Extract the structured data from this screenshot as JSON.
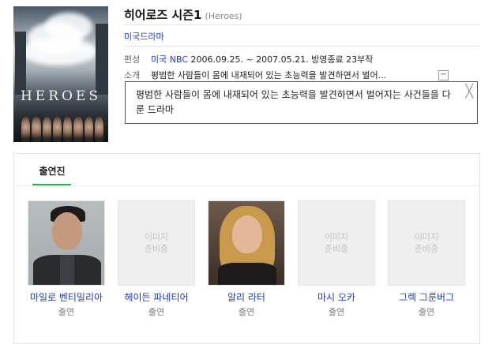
{
  "drama": {
    "title": "히어로즈 시즌1",
    "title_en": "(Heroes)",
    "genre": "미국드라마",
    "poster_logo": "HEROES"
  },
  "info": {
    "broadcast_label": "편성",
    "broadcaster": "미국 NBC",
    "period": "2006.09.25. ~ 2007.05.21.",
    "status": "방영종료 23부작",
    "summary_label": "소개",
    "summary_short": "평범한 사람들이 몸에 내재되어 있는 초능력을 발견하면서 벌어...",
    "collapse_symbol": "−"
  },
  "popup": {
    "text": "평범한 사람들이 몸에 내재되어 있는 초능력을 발견하면서 벌어지는 사건들을 다룬 드라마",
    "close_symbol": "╳"
  },
  "cast": {
    "tab_label": "출연진",
    "members": [
      {
        "name": "마일로 벤티밀리아",
        "role": "출연",
        "has_photo": true,
        "placeholder": ""
      },
      {
        "name": "헤이든 파네티어",
        "role": "출연",
        "has_photo": false,
        "placeholder": "이미지\n준비중"
      },
      {
        "name": "알리 라터",
        "role": "출연",
        "has_photo": true,
        "placeholder": ""
      },
      {
        "name": "마시 오카",
        "role": "출연",
        "has_photo": false,
        "placeholder": "이미지\n준비중"
      },
      {
        "name": "그렉 그룬버그",
        "role": "출연",
        "has_photo": false,
        "placeholder": "이미지\n준비중"
      }
    ]
  },
  "colors": {
    "link": "#1a3dc1",
    "tab_accent": "#27b34a",
    "placeholder_text": "#c2c2c2"
  }
}
